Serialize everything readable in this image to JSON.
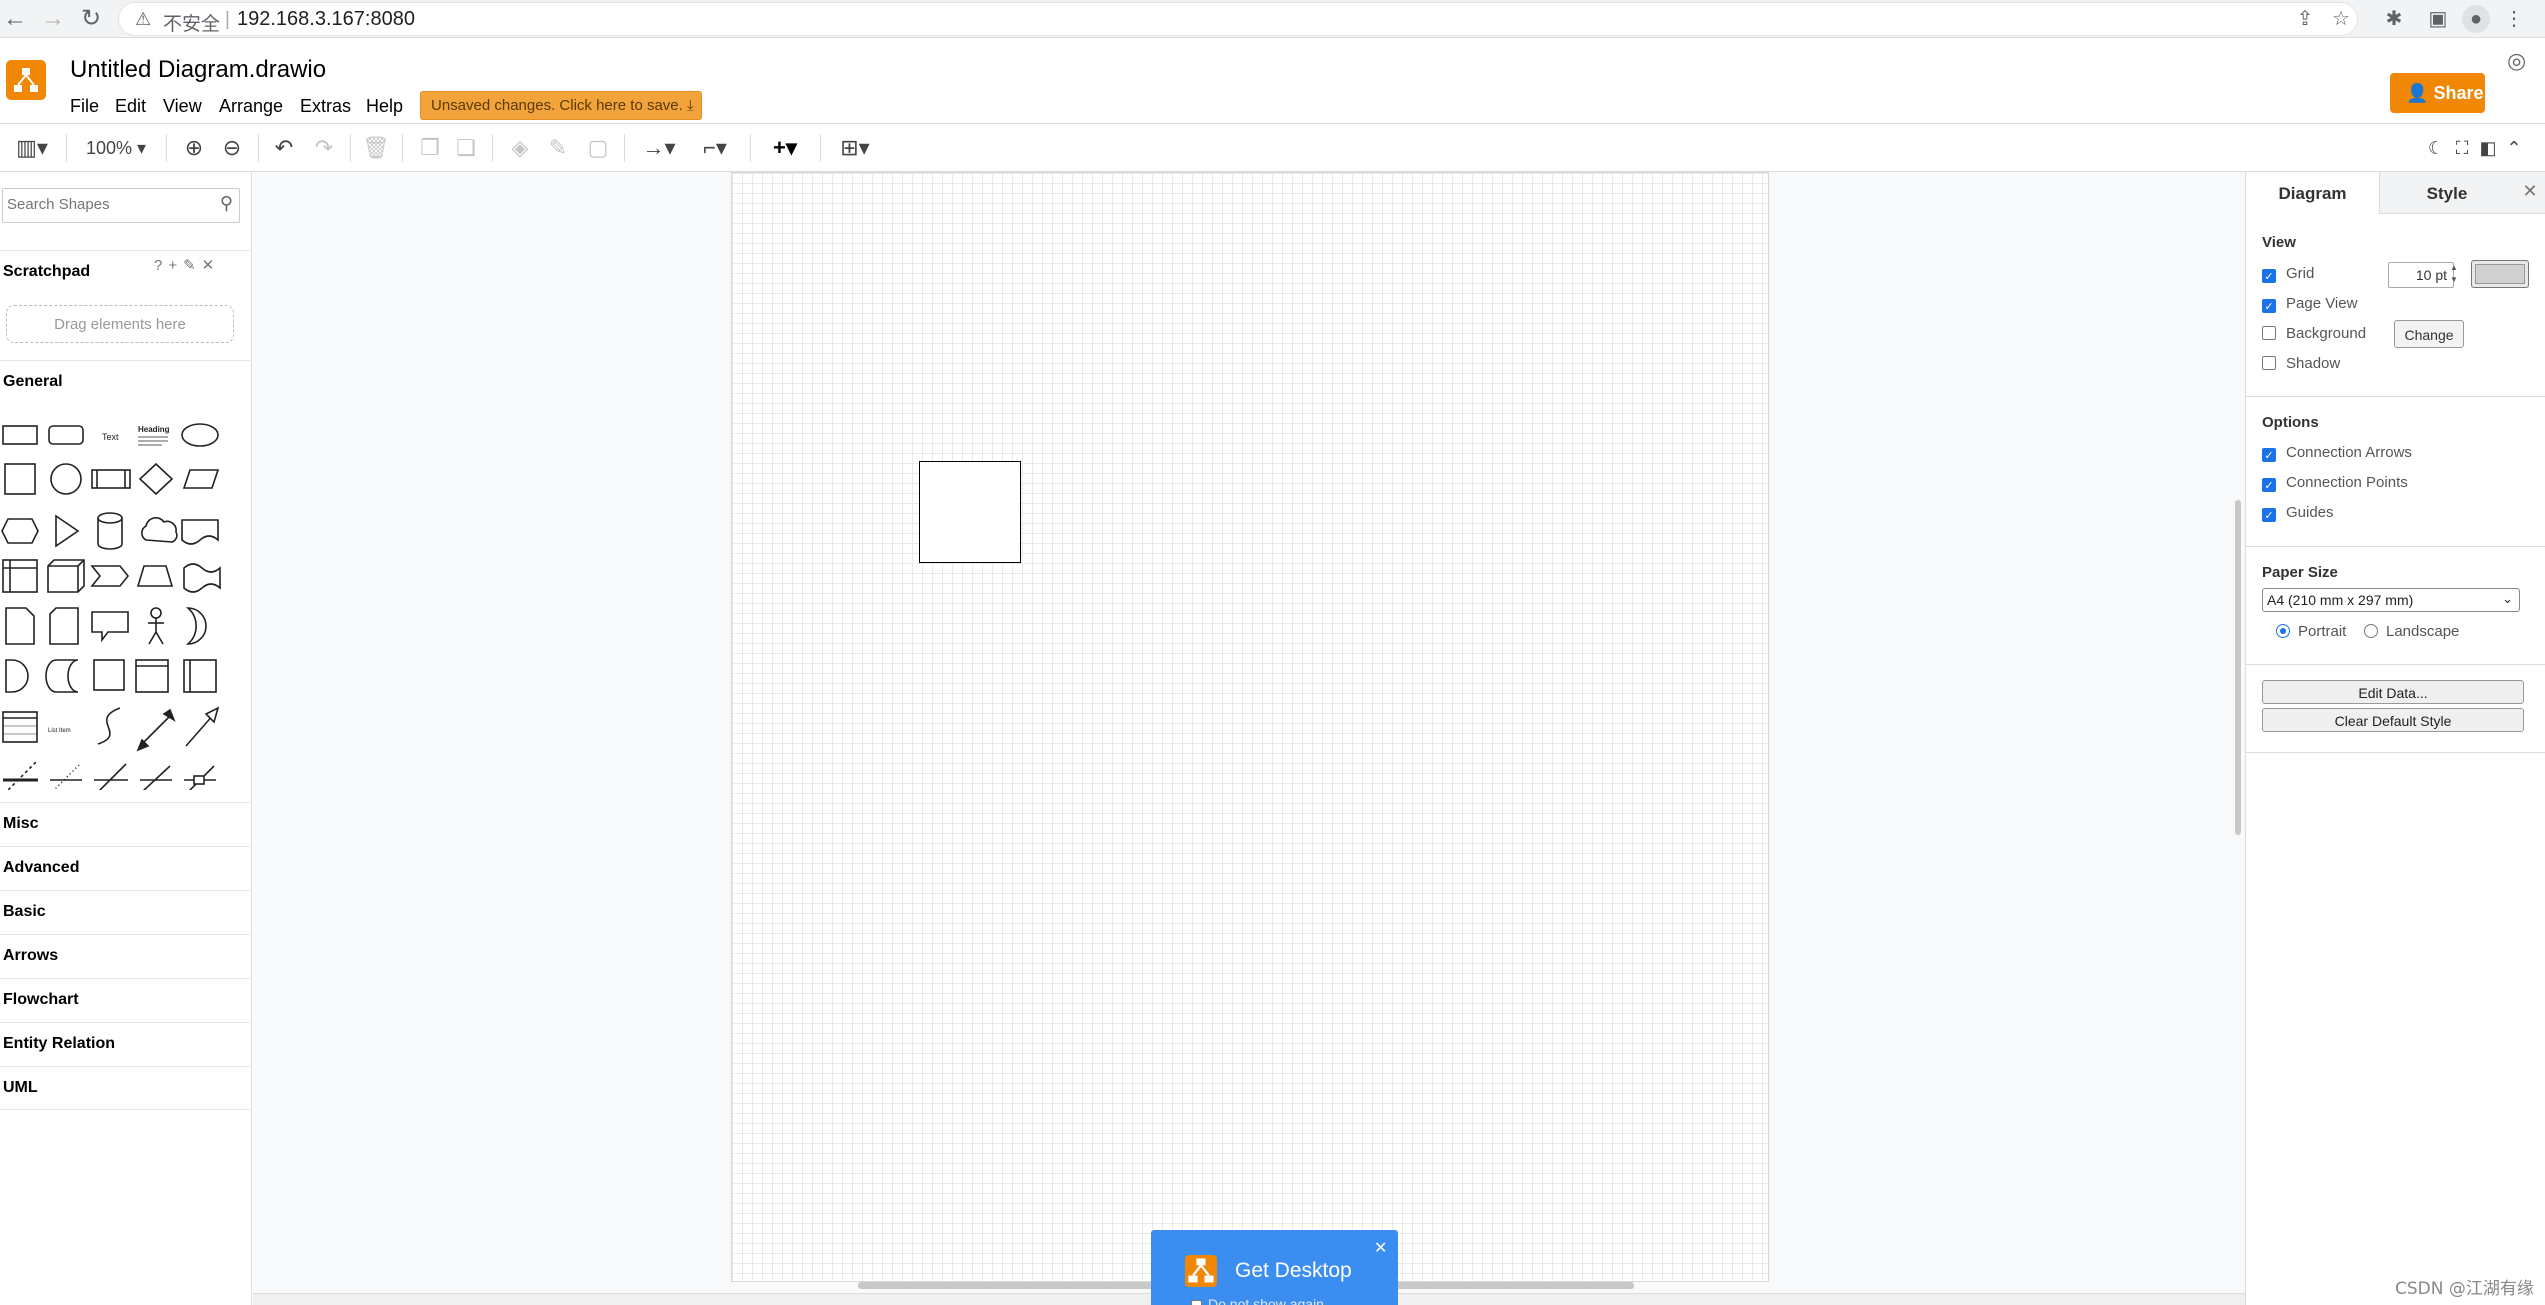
{
  "browser": {
    "insecure_label": "不安全",
    "url": "192.168.3.167:8080"
  },
  "header": {
    "file_name": "Untitled Diagram.drawio",
    "menus": [
      "File",
      "Edit",
      "View",
      "Arrange",
      "Extras",
      "Help"
    ],
    "unsaved_notice": "Unsaved changes. Click here to save.",
    "share_label": "Share"
  },
  "toolbar": {
    "zoom": "100%"
  },
  "left_panel": {
    "search_placeholder": "Search Shapes",
    "scratchpad_title": "Scratchpad",
    "scratchpad_tools": "?+✎✕",
    "drop_hint": "Drag elements here",
    "sections": [
      "General",
      "Misc",
      "Advanced",
      "Basic",
      "Arrows",
      "Flowchart",
      "Entity Relation",
      "UML"
    ]
  },
  "right_panel": {
    "tabs": [
      "Diagram",
      "Style"
    ],
    "view": {
      "title": "View",
      "grid_label": "Grid",
      "grid_checked": true,
      "grid_size": "10 pt",
      "page_view_label": "Page View",
      "page_view_checked": true,
      "background_label": "Background",
      "background_checked": false,
      "change_label": "Change",
      "shadow_label": "Shadow",
      "shadow_checked": false
    },
    "options": {
      "title": "Options",
      "connection_arrows": "Connection Arrows",
      "connection_points": "Connection Points",
      "guides": "Guides"
    },
    "paper": {
      "title": "Paper Size",
      "selected": "A4 (210 mm x 297 mm)",
      "portrait": "Portrait",
      "landscape": "Landscape",
      "orientation": "Portrait"
    },
    "buttons": {
      "edit_data": "Edit Data...",
      "clear_style": "Clear Default Style"
    }
  },
  "popup": {
    "title": "Get Desktop",
    "checkbox": "Do not show again"
  },
  "watermark": "CSDN @江湖有缘",
  "colors": {
    "accent": "#f08705",
    "popup_blue": "#3b8ef0",
    "check_blue": "#1a73e8"
  }
}
